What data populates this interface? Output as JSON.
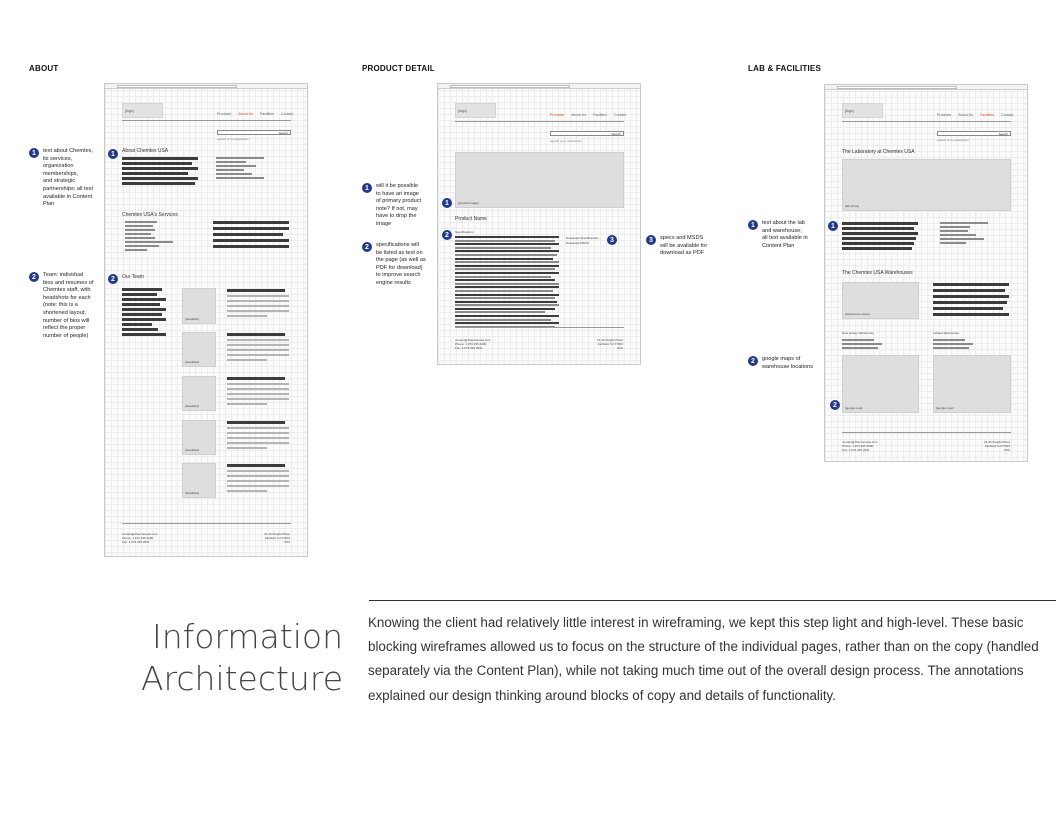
{
  "sections": {
    "about": "ABOUT",
    "product": "PRODUCT DETAIL",
    "lab": "LAB & FACILITIES"
  },
  "annotations": {
    "about_1": {
      "num": "1",
      "text": "text about Chemtex,\nits services,\norganization\nmemberships,\nand strategic\npartnerships; all text\navailable in Content\nPlan"
    },
    "about_2": {
      "num": "2",
      "text": "Team: individual\nbios and resumes of\nChemtex staff, with\nheadshots for each\n(note: this is a\nshortened layout;\nnumber of bios will\nreflect the proper\nnumber of people)"
    },
    "product_1": {
      "num": "1",
      "text": "will it be possible\nto have an image\nof primary product\nnote? If not, may\nhave to drop the\nimage"
    },
    "product_2": {
      "num": "2",
      "text": "specifications will\nbe listed as text on\nthe page (as well as\nPDF for download)\nto improve search\nengine results"
    },
    "product_3": {
      "num": "3",
      "text": "specs and MSDS\nwill be available for\ndownload as PDF"
    },
    "lab_1": {
      "num": "1",
      "text": "text about the lab\nand warehouse;\nall text available in\nContent Plan"
    },
    "lab_2": {
      "num": "2",
      "text": "google maps of\nwarehouse locations"
    }
  },
  "wireframe": {
    "logo": "[logo]",
    "nav": [
      "Products",
      "About Us",
      "Facilities",
      "Contact"
    ],
    "search_button": "Search",
    "search_hint": "search or by description",
    "footer_left": "contact@chemtexusa.com\nPhone: 1.973.335.2900\nFax: 1.973.335.2931",
    "footer_right": "21-26 Dwight Place\nFairfield, NJ 07004\nUSA",
    "about": {
      "heading": "About Chemtex USA",
      "services": "Chemtex USA's Services",
      "team": "Our Team",
      "headshot": "[headshot]"
    },
    "product": {
      "image": "[product image]",
      "name": "Product Name",
      "specs": "Specifications",
      "download_specs": "Download Specifications",
      "download_msds": "Download MSDS"
    },
    "lab": {
      "heading": "The Laboratory at Chemtex USA",
      "lab_photo": "[lab photo]",
      "warehouses": "The Chemtex USA Warehouses",
      "wh_photo": "[warehouse photo]",
      "wh_new_jersey": "New Jersey Warehouse",
      "wh_indiana": "Indiana Warehouse",
      "map": "[google map]"
    }
  },
  "title": {
    "line1": "Information",
    "line2": "Architecture"
  },
  "paragraph": "Knowing the client had relatively little interest in wireframing, we kept this step light and high-level. These basic blocking wireframes allowed us to focus on the structure of the individual pages, rather than on the copy (handled separately via the Content Plan), while not taking much time out of the overall design process. The annotations explained our design thinking around blocks of copy and details of functionality."
}
